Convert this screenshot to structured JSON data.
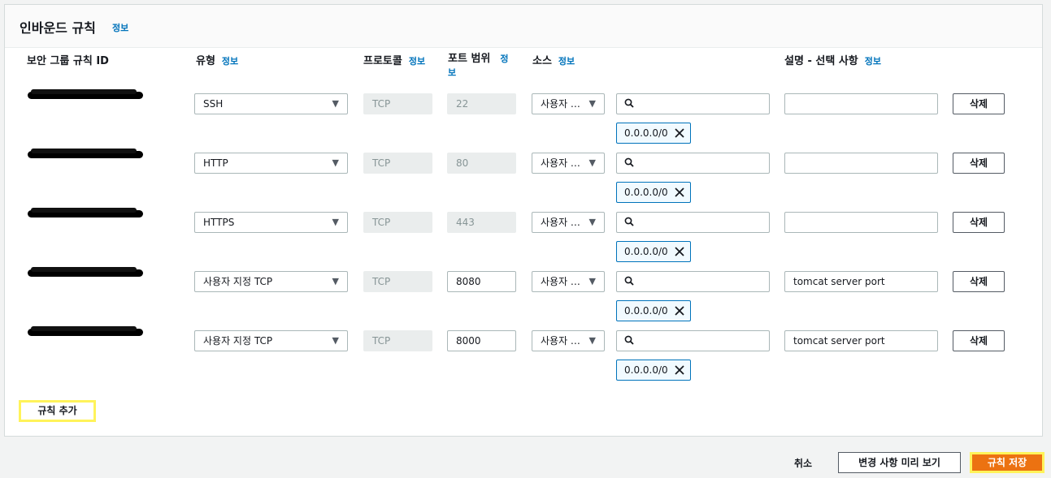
{
  "panel": {
    "title": "인바운드 규칙",
    "info": "정보"
  },
  "columns": {
    "rule_id": "보안 그룹 규칙 ID",
    "type": "유형",
    "protocol": "프로토콜",
    "port_range_a": "포트 범위",
    "port_range_b_1": "정",
    "port_range_b_2": "보",
    "source": "소스",
    "description": "설명 - 선택 사항",
    "info": "정보"
  },
  "rules": [
    {
      "type": "SSH",
      "protocol": "TCP",
      "port": "22",
      "port_editable": false,
      "source": "사용자 …",
      "search_value": "",
      "cidr": "0.0.0.0/0",
      "description": "",
      "delete": "삭제"
    },
    {
      "type": "HTTP",
      "protocol": "TCP",
      "port": "80",
      "port_editable": false,
      "source": "사용자 …",
      "search_value": "",
      "cidr": "0.0.0.0/0",
      "description": "",
      "delete": "삭제"
    },
    {
      "type": "HTTPS",
      "protocol": "TCP",
      "port": "443",
      "port_editable": false,
      "source": "사용자 …",
      "search_value": "",
      "cidr": "0.0.0.0/0",
      "description": "",
      "delete": "삭제"
    },
    {
      "type": "사용자 지정 TCP",
      "protocol": "TCP",
      "port": "8080",
      "port_editable": true,
      "source": "사용자 …",
      "search_value": "",
      "cidr": "0.0.0.0/0",
      "description": "tomcat server port",
      "delete": "삭제"
    },
    {
      "type": "사용자 지정 TCP",
      "protocol": "TCP",
      "port": "8000",
      "port_editable": true,
      "source": "사용자 …",
      "search_value": "",
      "cidr": "0.0.0.0/0",
      "description": "tomcat server port",
      "delete": "삭제"
    }
  ],
  "add_rule": "규칙 추가",
  "footer": {
    "cancel": "취소",
    "preview": "변경 사항 미리 보기",
    "save": "규칙 저장"
  },
  "colors": {
    "accent": "#ec7211",
    "link": "#0073bb",
    "highlight": "#fff35a",
    "chip_border": "#0073bb"
  },
  "icons": {
    "caret": "caret-down-icon",
    "search": "search-icon",
    "remove": "close-icon"
  }
}
